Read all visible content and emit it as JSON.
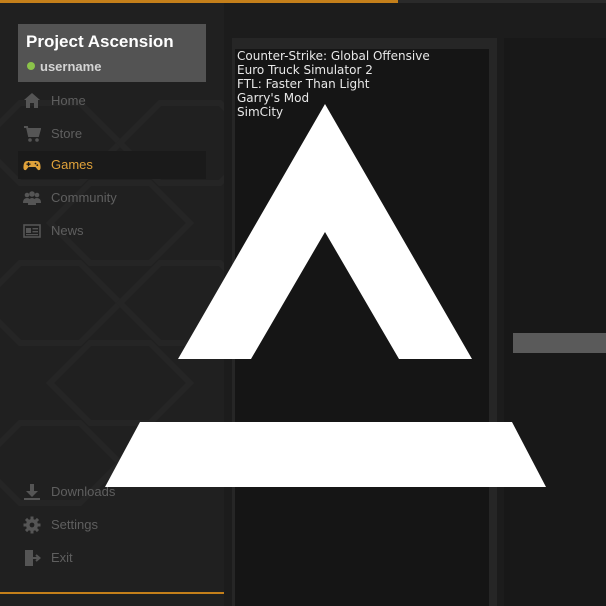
{
  "profile": {
    "app_name": "Project Ascension",
    "username": "username"
  },
  "nav": {
    "items": [
      {
        "label": "Home",
        "icon": "home-icon"
      },
      {
        "label": "Store",
        "icon": "cart-icon"
      },
      {
        "label": "Games",
        "icon": "gamepad-icon",
        "active": true
      },
      {
        "label": "Community",
        "icon": "users-icon"
      },
      {
        "label": "News",
        "icon": "newspaper-icon"
      }
    ],
    "bottom_items": [
      {
        "label": "Downloads",
        "icon": "download-icon"
      },
      {
        "label": "Settings",
        "icon": "gear-icon"
      },
      {
        "label": "Exit",
        "icon": "exit-icon"
      }
    ]
  },
  "games": [
    "Counter-Strike: Global Offensive",
    "Euro Truck Simulator 2",
    "FTL: Faster Than Light",
    "Garry's Mod",
    "SimCity"
  ],
  "colors": {
    "accent": "#c47f1a",
    "active_text": "#e0a23a",
    "online_status": "#8bc34a"
  }
}
